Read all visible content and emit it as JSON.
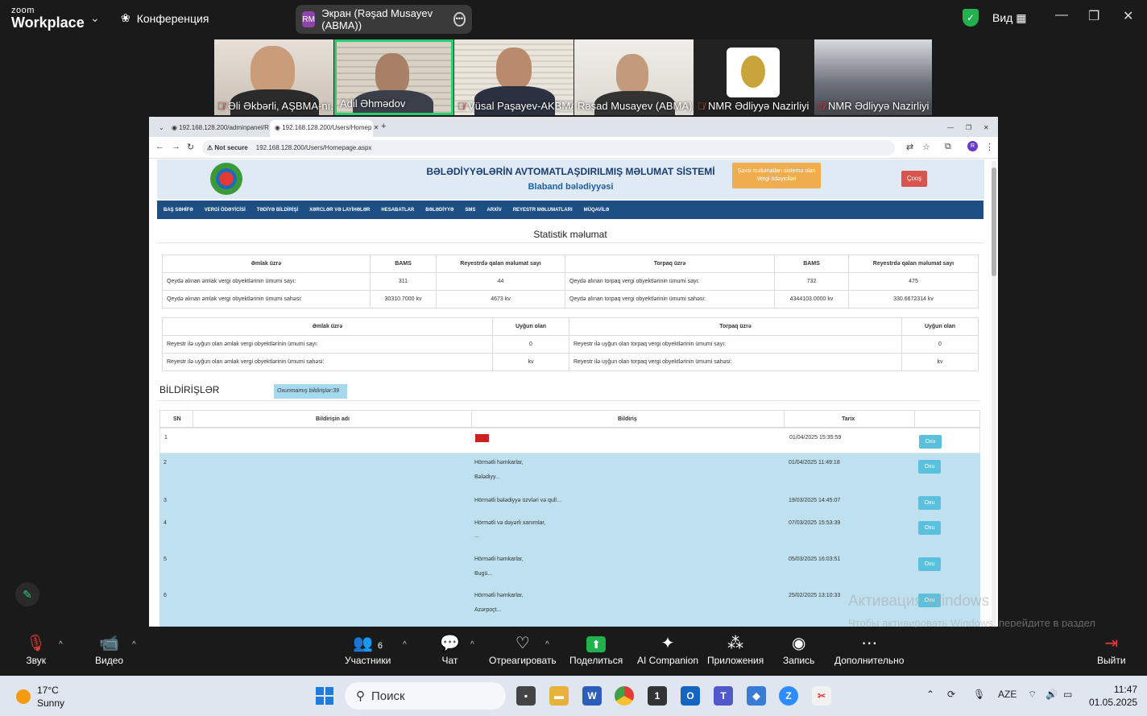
{
  "zoom": {
    "logo_small": "zoom",
    "logo_big": "Workplace",
    "conference_label": "Конференция",
    "screen_share_label": "Экран (Rəşad Musayev (ABMA))",
    "screen_badge": "RM",
    "view_label": "Вид",
    "participants": [
      {
        "name": "Əli Əkbərli, AŞBMA-nı...",
        "muted": true
      },
      {
        "name": "Adil Əhmədov",
        "muted": false,
        "active": true
      },
      {
        "name": "Vüsal Paşayev-AKBMA,...",
        "muted": true
      },
      {
        "name": "Rəşad Musayev (ABMA)",
        "muted": false
      },
      {
        "name": "NMR Ədliyyə Nazirliyi",
        "muted": true
      },
      {
        "name": "NMR Ədliyyə Nazirliyi",
        "muted": true
      }
    ],
    "toolbar": {
      "audio": "Звук",
      "video": "Видео",
      "participants": "Участники",
      "participants_count": "6",
      "chat": "Чат",
      "react": "Отреагировать",
      "share": "Поделиться",
      "ai": "AI Companion",
      "apps": "Приложения",
      "record": "Запись",
      "more": "Дополнительно",
      "leave": "Выйти"
    }
  },
  "browser": {
    "tabs": [
      "192.168.128.200/adminpanel/R",
      "192.168.128.200/Users/Homep"
    ],
    "not_secure": "Not secure",
    "url": "192.168.128.200/Users/Homepage.aspx",
    "profile_initial": "R"
  },
  "site": {
    "title": "BƏLƏDİYYƏLƏRİN AVTOMATLAŞDIRILMIŞ MƏLUMAT SİSTEMİ",
    "subtitle": "Blaband bələdiyyəsi",
    "orange_button": "Şəxsi məlumatları sistemə olan Vergi ödəyiciləri",
    "exit_button": "Çıxış",
    "nav": [
      "BAŞ SƏHİFƏ",
      "VERGİ ÖDƏYİCİSİ",
      "TƏDİYƏ BİLDİRİŞİ",
      "XƏRCLƏR VƏ LAYİHƏLƏR",
      "HESABATLAR",
      "BƏLƏDİYYƏ",
      "SMS",
      "ARXİV",
      "REYESTR MƏLUMATLARI",
      "MÜQAVİLƏ"
    ],
    "stat_title": "Statistik məlumat",
    "table1": {
      "headers": [
        "Əmlak üzrə",
        "BAMS",
        "Reyestrdə qalan məlumat sayı",
        "Torpaq üzrə",
        "BAMS",
        "Reyestrdə qalan məlumat sayı"
      ],
      "rows": [
        [
          "Qeydə alınan əmlak vergi obyektlərinin ümumi sayı:",
          "311",
          "44",
          "Qeydə alınan torpaq vergi obyektlərinin ümumi sayı:",
          "732",
          "475"
        ],
        [
          "Qeydə alınan əmlak vergi obyektlərinin ümumi sahəsi:",
          "30310.7000 kv",
          "4673 kv",
          "Qeydə alınan torpaq vergi obyektlərinin ümumi sahəsi:",
          "4344103.0000 kv",
          "330.6672314 kv"
        ]
      ]
    },
    "table2": {
      "headers": [
        "Əmlak üzrə",
        "Uyğun olan",
        "Torpaq üzrə",
        "Uyğun olan"
      ],
      "rows": [
        [
          "Reyestr ilə uyğun olan əmlak vergi obyektlərinin ümumi sayı:",
          "0",
          "Reyestr ilə uyğun olan torpaq vergi obyektlərinin ümumi sayı:",
          "0"
        ],
        [
          "Reyestr ilə uyğun olan əmlak vergi obyektlərinin ümumi sahəsi:",
          "kv",
          "Reyestr ilə uyğun olan torpaq vergi obyektlərinin ümumi sahəsi:",
          "kv"
        ]
      ]
    },
    "notifications_title": "BİLDİRİŞLƏR",
    "unread_label": "Oxunmamış bildirişlər:39",
    "notif_headers": [
      "SN",
      "Bildirişin adı",
      "Bildiriş",
      "Tarix"
    ],
    "read_button": "Oxu",
    "notifications": [
      {
        "sn": "1",
        "line1": "",
        "line2": "",
        "date": "01/04/2025 15:35:59",
        "flag": true
      },
      {
        "sn": "2",
        "line1": "Hörmətli həmkarlar,",
        "line2": "Bələdiyy...",
        "date": "01/04/2025 11:49:18"
      },
      {
        "sn": "3",
        "line1": "Hörmətli bələdiyyə üzvləri və qull...",
        "line2": "",
        "date": "19/03/2025 14:45:07"
      },
      {
        "sn": "4",
        "line1": "Hörmətli və dəyərli xanımlar,",
        "line2": "...",
        "date": "07/03/2025 15:53:39"
      },
      {
        "sn": "5",
        "line1": "Hörmətli həmkarlar,",
        "line2": "Bugü...",
        "date": "05/03/2025 16:03:51"
      },
      {
        "sn": "6",
        "line1": "Hörmətli həmkarlar,",
        "line2": "Azərpoçt...",
        "date": "25/02/2025 13:10:33"
      }
    ]
  },
  "watermark": {
    "line1": "Активация Windows",
    "line2": "Чтобы активировать Windows, перейдите в раздел \"Параметры\"."
  },
  "taskbar": {
    "temp": "17°C",
    "weather": "Sunny",
    "search": "Поиск",
    "lang": "AZE",
    "time": "11:47",
    "date": "01.05.2025"
  },
  "colors": {
    "zoom_bg": "#1a1a1a",
    "active_tile": "#2ecc71",
    "nav_blue": "#1d4f84",
    "highlight_row": "#bfe0ef",
    "oxu_button": "#5bc0de"
  }
}
